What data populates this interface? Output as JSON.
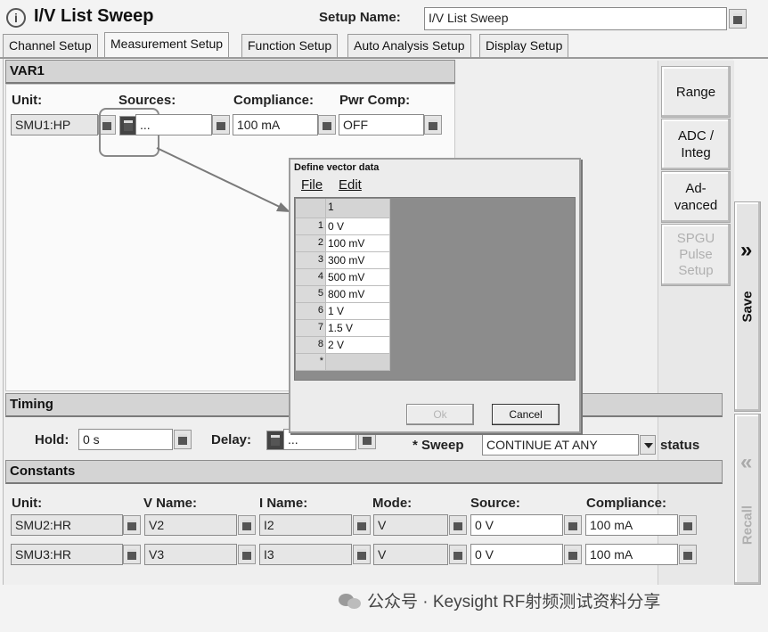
{
  "header": {
    "title": "I/V List Sweep",
    "setup_name_label": "Setup Name:",
    "setup_name_value": "I/V List Sweep"
  },
  "tabs": [
    {
      "label": "Channel Setup"
    },
    {
      "label": "Measurement Setup"
    },
    {
      "label": "Function Setup"
    },
    {
      "label": "Auto Analysis Setup"
    },
    {
      "label": "Display Setup"
    }
  ],
  "var1": {
    "section_title": "VAR1",
    "unit_label": "Unit:",
    "sources_label": "Sources:",
    "compliance_label": "Compliance:",
    "pwr_comp_label": "Pwr Comp:",
    "unit_value": "SMU1:HP",
    "sources_value": "...",
    "compliance_value": "100 mA",
    "pwr_comp_value": "OFF"
  },
  "side_buttons": {
    "range": "Range",
    "adc_line1": "ADC /",
    "adc_line2": "Integ",
    "adv_line1": "Ad-",
    "adv_line2": "vanced",
    "spgu_line1": "SPGU",
    "spgu_line2": "Pulse",
    "spgu_line3": "Setup",
    "save": "Save",
    "recall": "Recall",
    "save_chevron": "»",
    "recall_chevron": "«"
  },
  "dialog": {
    "title": "Define vector data",
    "menu_file": "File",
    "menu_edit": "Edit",
    "column_header": "1",
    "rows": [
      {
        "num": "1",
        "value": "0 V"
      },
      {
        "num": "2",
        "value": "100 mV"
      },
      {
        "num": "3",
        "value": "300 mV"
      },
      {
        "num": "4",
        "value": "500 mV"
      },
      {
        "num": "5",
        "value": "800 mV"
      },
      {
        "num": "6",
        "value": "1 V"
      },
      {
        "num": "7",
        "value": "1.5 V"
      },
      {
        "num": "8",
        "value": "2 V"
      },
      {
        "num": "*",
        "value": ""
      }
    ],
    "ok_label": "Ok",
    "cancel_label": "Cancel"
  },
  "timing": {
    "section_title": "Timing",
    "hold_label": "Hold:",
    "hold_value": "0 s",
    "delay_label": "Delay:",
    "delay_value": "...",
    "sweep_label": "* Sweep",
    "sweep_value": "CONTINUE AT ANY",
    "status_label": "status"
  },
  "constants": {
    "section_title": "Constants",
    "headers": {
      "unit": "Unit:",
      "vname": "V Name:",
      "iname": "I Name:",
      "mode": "Mode:",
      "source": "Source:",
      "compliance": "Compliance:"
    },
    "rows": [
      {
        "unit": "SMU2:HR",
        "vname": "V2",
        "iname": "I2",
        "mode": "V",
        "source": "0 V",
        "compliance": "100 mA"
      },
      {
        "unit": "SMU3:HR",
        "vname": "V3",
        "iname": "I3",
        "mode": "V",
        "source": "0 V",
        "compliance": "100 mA"
      }
    ]
  },
  "watermark": {
    "text": "公众号 · Keysight RF射频测试资料分享"
  }
}
